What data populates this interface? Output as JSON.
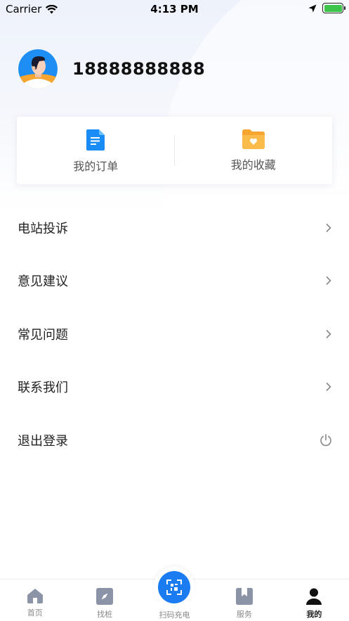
{
  "status_bar": {
    "carrier": "Carrier",
    "time": "4:13 PM"
  },
  "profile": {
    "phone": "18888888888"
  },
  "quick_card": {
    "items": [
      {
        "label": "我的订单",
        "icon": "document-icon",
        "color": "#1a8cf5"
      },
      {
        "label": "我的收藏",
        "icon": "heart-folder-icon",
        "color": "#f7a531"
      }
    ]
  },
  "menu": {
    "items": [
      {
        "label": "电站投诉",
        "icon": "chevron-right-icon"
      },
      {
        "label": "意见建议",
        "icon": "chevron-right-icon"
      },
      {
        "label": "常见问题",
        "icon": "chevron-right-icon"
      },
      {
        "label": "联系我们",
        "icon": "chevron-right-icon"
      },
      {
        "label": "退出登录",
        "icon": "power-icon"
      }
    ]
  },
  "tabbar": {
    "items": [
      {
        "label": "首页",
        "icon": "home-icon"
      },
      {
        "label": "找桩",
        "icon": "compass-icon"
      },
      {
        "label": "扫码充电",
        "icon": "scan-icon"
      },
      {
        "label": "服务",
        "icon": "service-book-icon"
      },
      {
        "label": "我的",
        "icon": "user-icon",
        "active": true
      }
    ]
  },
  "colors": {
    "accent": "#1a7cf0",
    "orange": "#f7a531"
  }
}
